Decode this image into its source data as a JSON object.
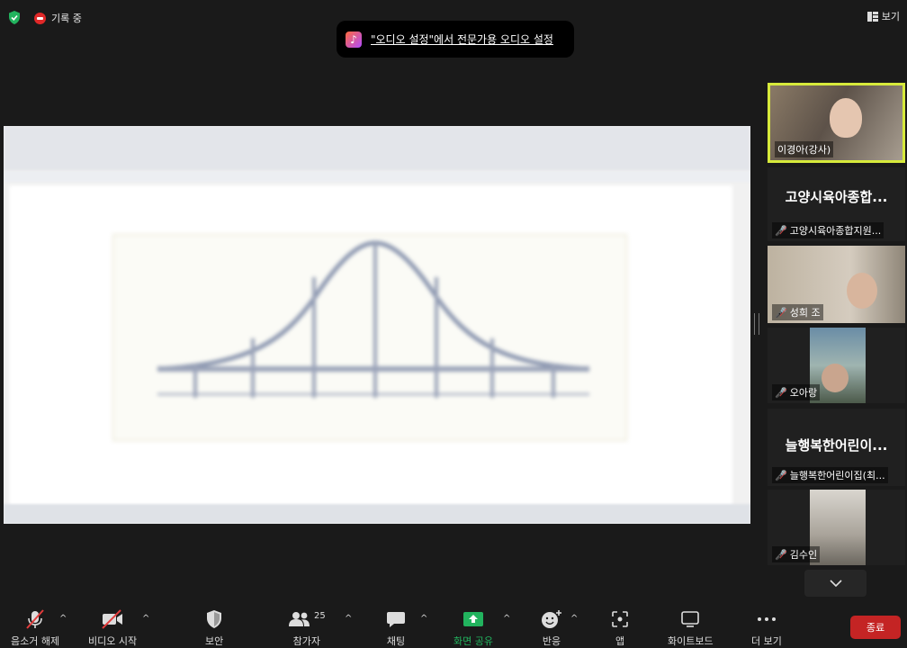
{
  "top": {
    "recording_label": "기록 중",
    "view_label": "보기",
    "notice_text": "\"오디오 설정\"에서 전문가용 오디오 설정"
  },
  "participants": [
    {
      "name": "이경아(강사)",
      "video": true,
      "active": true
    },
    {
      "name": "고양시육아종합지원...",
      "display": "고양시육아종합...",
      "video": false,
      "muted": true
    },
    {
      "name": "성희 조",
      "video": true,
      "muted": true
    },
    {
      "name": "오아랑",
      "video": true,
      "muted": true
    },
    {
      "name": "늘행복한어린이집(최...",
      "display": "늘행복한어린이...",
      "video": false,
      "muted": true
    },
    {
      "name": "김수인",
      "video": true,
      "muted": true
    }
  ],
  "toolbar": {
    "unmute": "음소거 해제",
    "start_video": "비디오 시작",
    "security": "보안",
    "participants": "참가자",
    "participant_count": "25",
    "chat": "채팅",
    "share_screen": "화면 공유",
    "reactions": "반응",
    "apps": "앱",
    "whiteboard": "화이트보드",
    "more": "더 보기",
    "end": "종료"
  },
  "colors": {
    "background": "#1a1a1a",
    "share_green": "#22b35e",
    "end_red": "#c42424",
    "active_border": "#d7ea3b",
    "muted_red": "#e23c3c"
  }
}
